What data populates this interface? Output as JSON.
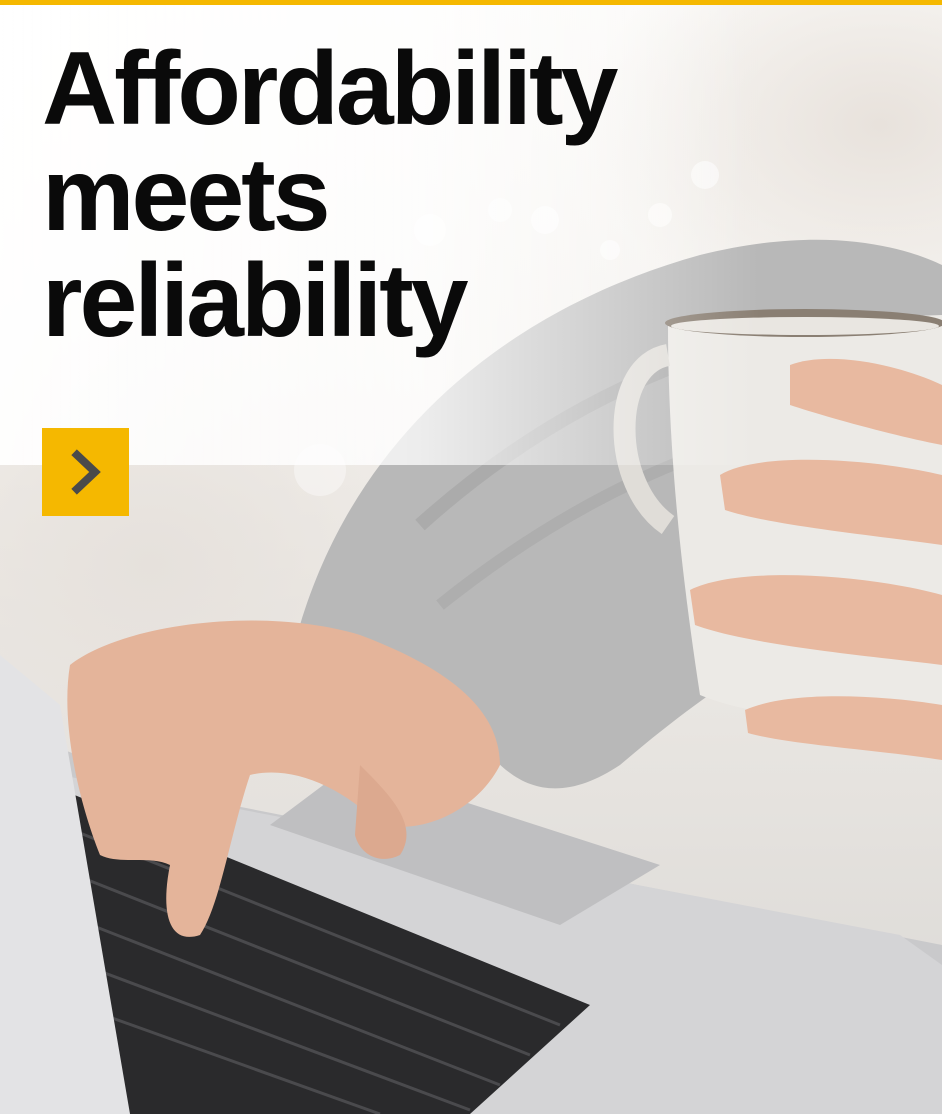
{
  "banner": {
    "headline_lines": [
      "Affordability",
      "meets",
      "reliability"
    ],
    "cta": {
      "icon": "chevron-right-icon"
    },
    "photo": {
      "icon": "photo"
    }
  },
  "colors": {
    "accent": "#f5b800",
    "headline": "#0a0a0a",
    "chevron": "#4a4a4a"
  }
}
